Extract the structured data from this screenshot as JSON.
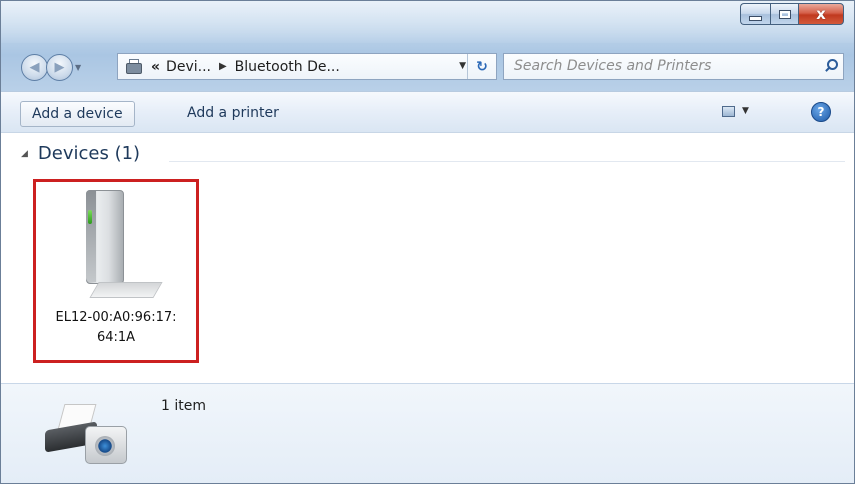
{
  "window": {
    "minimize_icon": "minimize-icon",
    "maximize_icon": "maximize-icon",
    "close_glyph": "x"
  },
  "address": {
    "chevrons": "«",
    "crumbs": [
      "Devi...",
      "Bluetooth De..."
    ]
  },
  "search": {
    "placeholder": "Search Devices and Printers"
  },
  "toolbar": {
    "add_device": "Add a device",
    "add_printer": "Add a printer",
    "help_glyph": "?"
  },
  "group": {
    "label": "Devices (1)"
  },
  "devices": [
    {
      "name_line1": "EL12-00:A0:96:17:",
      "name_line2": "64:1A"
    }
  ],
  "details": {
    "count": "1 item"
  },
  "colors": {
    "selection_border": "#cc2020",
    "link_text": "#1e395b"
  }
}
